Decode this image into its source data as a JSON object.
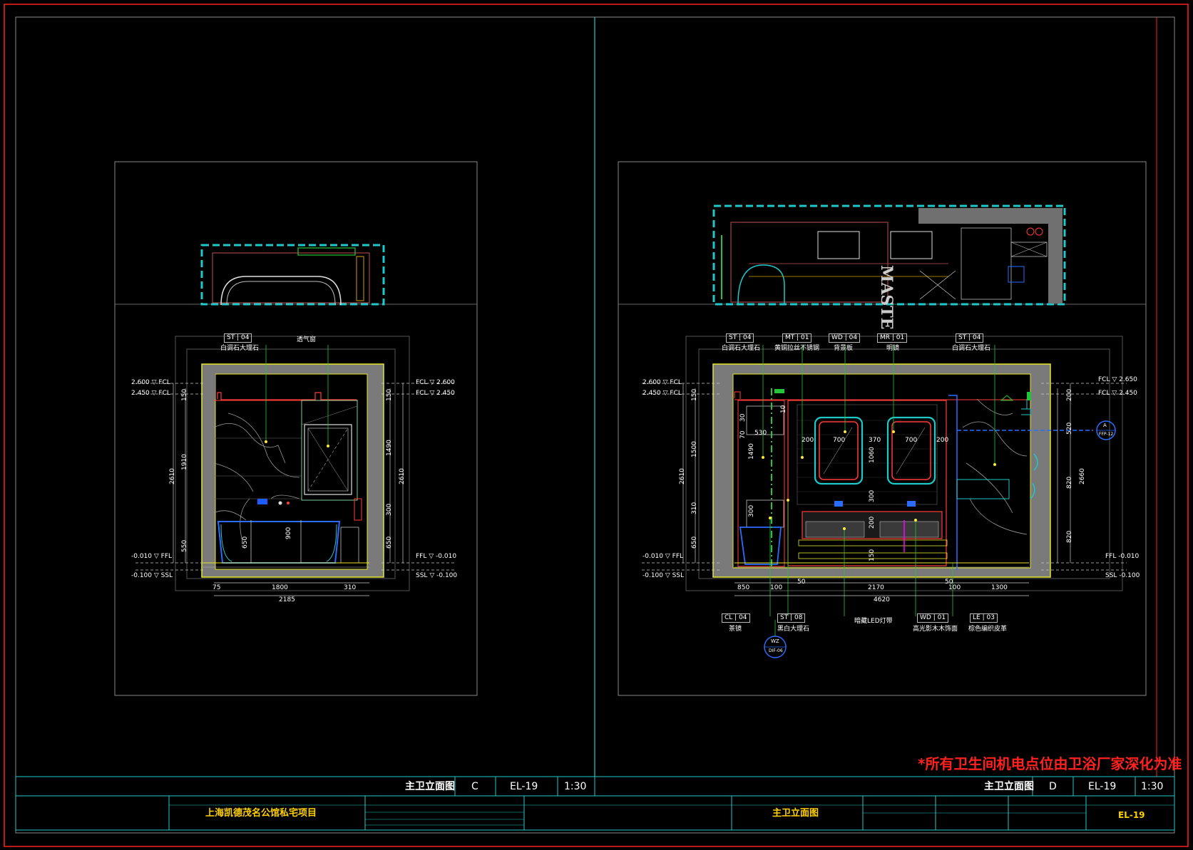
{
  "title_bar": {
    "left": {
      "title": "主卫立面图",
      "code": "C",
      "sheet": "EL-19",
      "scale": "1:30"
    },
    "right": {
      "title": "主卫立面图",
      "code": "D",
      "sheet": "EL-19",
      "scale": "1:30"
    }
  },
  "note": "*所有卫生间机电点位由卫浴厂家深化为准",
  "info_block": {
    "project_name": "上海凯德茂名公馆私宅项目",
    "drawing_title": "主卫立面图",
    "sheet_no": "EL-19"
  },
  "elevation_c": {
    "tags": [
      {
        "code": "ST",
        "num": "04",
        "desc": "白调石大理石"
      },
      {
        "desc": "透气窗"
      }
    ],
    "levels": {
      "top": "2.600",
      "top_tag": "FCL",
      "ceiling": "2.450",
      "ceiling_tag": "FCL",
      "floor": "-0.010",
      "floor_tag": "FFL",
      "slab": "-0.100",
      "slab_tag": "SSL"
    },
    "dims_left": [
      "150",
      "1910",
      "550",
      "2610"
    ],
    "dims_right": [
      "150",
      "1490",
      "300",
      "650",
      "2610"
    ],
    "dims_inner": [
      "650",
      "900"
    ],
    "dims_bottom": [
      "75",
      "1800",
      "310"
    ],
    "dims_total": "2185"
  },
  "elevation_d": {
    "tags_top": [
      {
        "code": "ST",
        "num": "04",
        "desc": "白调石大理石"
      },
      {
        "code": "MT",
        "num": "01",
        "desc": "黄铜拉丝不锈钢"
      },
      {
        "code": "WD",
        "num": "04",
        "desc": "背景板"
      },
      {
        "code": "MR",
        "num": "01",
        "desc": "明镜"
      },
      {
        "code": "ST",
        "num": "04",
        "desc": "白调石大理石"
      }
    ],
    "tags_bottom": [
      {
        "code": "CL",
        "num": "04",
        "desc": "茶镜"
      },
      {
        "code": "ST",
        "num": "08",
        "desc": "黑白大理石"
      },
      {
        "code": "",
        "num": "",
        "desc": "暗藏LED灯带"
      },
      {
        "code": "WD",
        "num": "01",
        "desc": "高光影木木饰面"
      },
      {
        "code": "LE",
        "num": "03",
        "desc": "棕色编织皮革"
      }
    ],
    "levels_left": {
      "top": "2.600",
      "ceiling": "2.450",
      "floor": "-0.010",
      "slab": "-0.100"
    },
    "levels_right": {
      "top": "2.650",
      "ceiling": "2.450",
      "floor": "-0.010",
      "slab": "-0.100"
    },
    "dims_left": [
      "150",
      "1500",
      "310",
      "650",
      "2610"
    ],
    "dims_right": [
      "200",
      "520",
      "820",
      "820",
      "2660"
    ],
    "dims_mirror": [
      "200",
      "700",
      "370",
      "700",
      "200"
    ],
    "dims_inner": [
      "1060",
      "300",
      "200",
      "150",
      "1490",
      "530",
      "300",
      "70",
      "30",
      "10"
    ],
    "dims_bottom": [
      "850",
      "100",
      "50",
      "2170",
      "50",
      "100",
      "1300"
    ],
    "dims_total": "4620",
    "brand_text": "MASTE",
    "callout_a": {
      "code": "A",
      "ref": "FFP-12"
    },
    "callout_b": {
      "code": "WZ",
      "ref": "DIF-06"
    }
  }
}
